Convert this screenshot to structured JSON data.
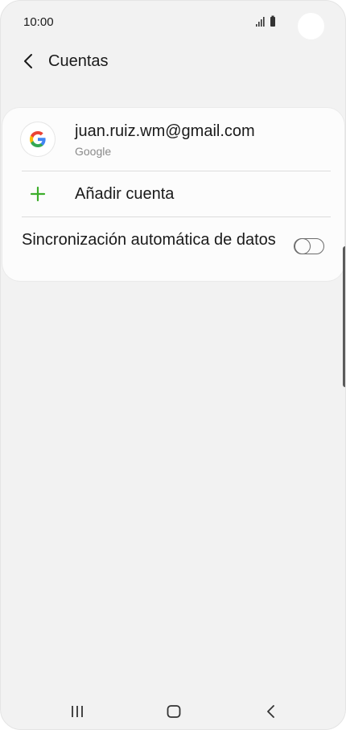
{
  "status_bar": {
    "time": "10:00",
    "icons": [
      "signal-icon",
      "battery-icon"
    ]
  },
  "header": {
    "back_icon": "chevron-left-icon",
    "title": "Cuentas"
  },
  "accounts": [
    {
      "icon": "google-icon",
      "email": "juan.ruiz.wm@gmail.com",
      "type": "Google"
    }
  ],
  "add_account": {
    "icon": "plus-icon",
    "label": "Añadir cuenta"
  },
  "sync": {
    "label": "Sincronización automática de datos",
    "enabled": false
  },
  "nav_bar": {
    "buttons": [
      "recent-apps-icon",
      "home-icon",
      "back-icon"
    ]
  },
  "colors": {
    "background": "#f2f2f2",
    "card": "#fcfcfc",
    "accent_green": "#3dae2b",
    "text_primary": "#1a1a1a",
    "text_secondary": "#8a8a8a"
  }
}
